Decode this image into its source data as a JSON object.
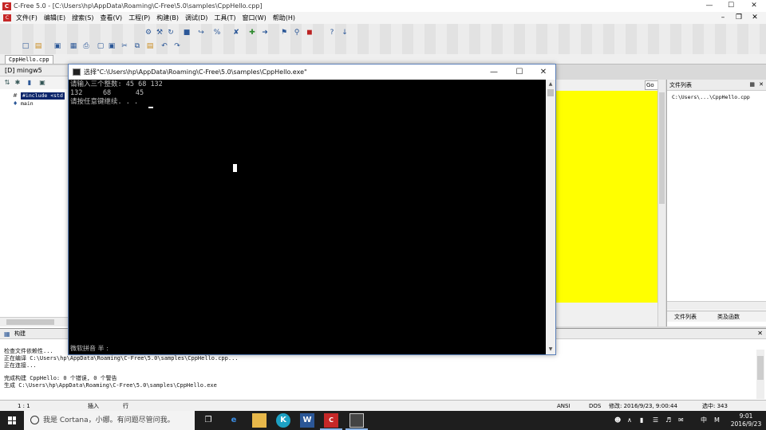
{
  "main_window": {
    "title": "C-Free 5.0 - [C:\\Users\\hp\\AppData\\Roaming\\C-Free\\5.0\\samples\\CppHello.cpp]",
    "app_icon_text": "C"
  },
  "menu": {
    "items": [
      "文件(F)",
      "编辑(E)",
      "搜索(S)",
      "查看(V)",
      "工程(P)",
      "构建(B)",
      "调试(D)",
      "工具(T)",
      "窗口(W)",
      "帮助(H)"
    ]
  },
  "file_tab": {
    "label": "CppHello.cpp"
  },
  "left_panel": {
    "title": "[D] mingw5",
    "tree": [
      {
        "label": "#include <std",
        "icon": "hash-icon"
      },
      {
        "label": "main",
        "icon": "function-icon"
      }
    ]
  },
  "function_combo": {
    "label": "Go"
  },
  "right_panel": {
    "title": "文件列表",
    "file": "C:\\Users\\...\\CppHello.cpp",
    "tabs": [
      "文件列表",
      "类及函数"
    ]
  },
  "build_panel": {
    "title": "构建",
    "lines": [
      "检查文件依赖性...",
      "正在编译 C:\\Users\\hp\\AppData\\Roaming\\C-Free\\5.0\\samples\\CppHello.cpp...",
      "正在连接...",
      "",
      "完成构建 CppHello: 0 个错误, 0 个警告",
      "生成 C:\\Users\\hp\\AppData\\Roaming\\C-Free\\5.0\\samples\\CppHello.exe"
    ]
  },
  "status_bar": {
    "position": "1 : 1",
    "insert_mode": "插入",
    "line_label": "行",
    "encoding": "ANSI",
    "line_ending": "DOS",
    "modified": "修改: 2016/9/23, 9:00:44",
    "selection": "选中: 343"
  },
  "console": {
    "title": "选择\"C:\\Users\\hp\\AppData\\Roaming\\C-Free\\5.0\\samples\\CppHello.exe\"",
    "lines": [
      "请输入三个整数: 45 68 132",
      "132     68      45",
      "请按任意键继续. . . "
    ],
    "ime": "微软拼音 半 :"
  },
  "taskbar": {
    "search_placeholder": "我是 Cortana，小娜。有问题尽管问我。",
    "tray_lang": "中",
    "tray_ime": "M",
    "time": "9:01",
    "date": "2016/9/23"
  },
  "colors": {
    "console_bg": "#000000",
    "console_text": "#c0c0c0",
    "editor_highlight": "#ffff00",
    "taskbar": "#1e1e1e",
    "selection": "#0a246a"
  }
}
